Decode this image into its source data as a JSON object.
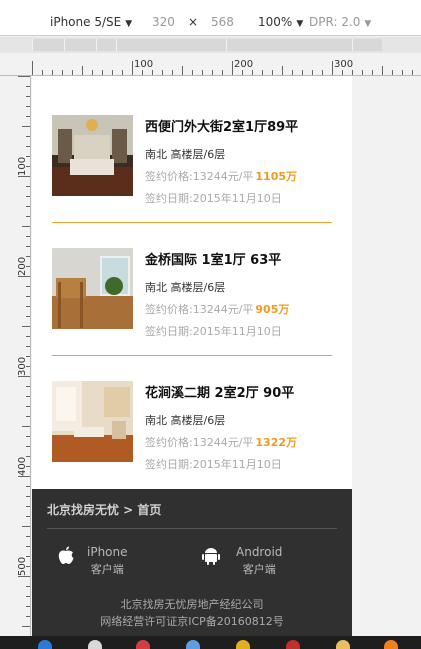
{
  "devtools": {
    "device": "iPhone 5/SE",
    "width": "320",
    "times": "×",
    "height": "568",
    "zoom": "100%",
    "dpr": "DPR: 2.0"
  },
  "ruler": {
    "h_labels": [
      "100",
      "200",
      "300"
    ],
    "v_labels": [
      "100",
      "200",
      "300",
      "400",
      "500"
    ]
  },
  "listings": [
    {
      "title": "西便门外大街2室1厅89平",
      "layout": "南北 高楼层/6层",
      "price_label": "签约价格:13244元/平",
      "price": "1105万",
      "date": "签约日期:2015年11月10日"
    },
    {
      "title": "金桥国际 1室1厅 63平",
      "layout": "南北 高楼层/6层",
      "price_label": "签约价格:13244元/平",
      "price": "905万",
      "date": "签约日期:2015年11月10日"
    },
    {
      "title": "花涧溪二期 2室2厅 90平",
      "layout": "南北 高楼层/6层",
      "price_label": "签约价格:13244元/平",
      "price": "1322万",
      "date": "签约日期:2015年11月10日"
    }
  ],
  "footer": {
    "breadcrumb": "北京找房无忧 > 首页",
    "iphone_name": "iPhone",
    "iphone_sub": "客户端",
    "android_name": "Android",
    "android_sub": "客户端",
    "company": "北京找房无忧房地产经纪公司",
    "icp": "网络经营许可证京ICP备20160812号"
  },
  "colors": {
    "accent": "#f29a1e",
    "divider": "#f0a030",
    "footer_bg": "#303030"
  },
  "icons": [
    "apple-icon",
    "android-icon"
  ]
}
